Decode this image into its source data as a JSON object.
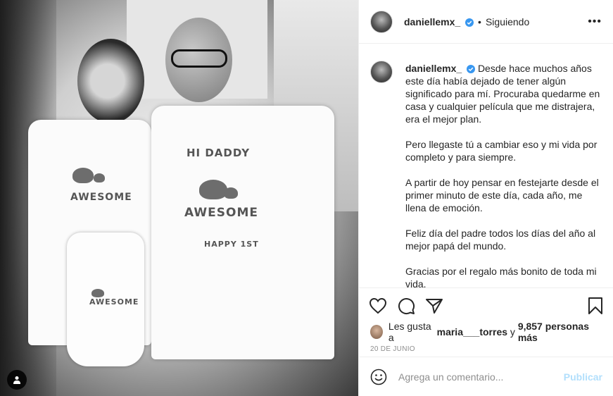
{
  "post": {
    "image_tag_icon": "user-tag-icon",
    "shirt_texts": {
      "hi_daddy": "HI DADDY",
      "awesome_big": "AWESOME",
      "happy_first": "HAPPY 1ST",
      "awesome_left": "AWESOME",
      "awesome_onesie": "AWESOME"
    }
  },
  "header": {
    "username": "daniellemx_",
    "separator": "•",
    "follow_status": "Siguiendo",
    "more_icon": "more-options-icon",
    "more_label": "•••"
  },
  "caption": {
    "username": "daniellemx_",
    "paragraphs": [
      "Desde hace muchos años este día había dejado de tener algún significado para mí. Procuraba quedarme en casa y cualquier película que me distrajera, era el mejor plan.",
      "Pero llegaste tú a cambiar eso y mi vida por completo y para siempre.",
      "A partir de hoy pensar en festejarte desde el primer minuto de este día, cada año, me llena de emoción.",
      "Feliz día del padre todos los días del año al mejor papá del mundo.",
      "Gracias por el regalo más bonito de toda mi vida."
    ]
  },
  "actions": {
    "like_icon": "heart-icon",
    "comment_icon": "comment-icon",
    "share_icon": "share-icon",
    "save_icon": "bookmark-icon"
  },
  "likes": {
    "prefix": "Les gusta a",
    "user": "maria___torres",
    "joiner": "y",
    "others": "9,857 personas más"
  },
  "date": "20 DE JUNIO",
  "comment": {
    "placeholder": "Agrega un comentario...",
    "publish_label": "Publicar",
    "emoji_icon": "emoji-icon"
  },
  "colors": {
    "verified": "#3897f0",
    "publish_disabled": "#b2dffc",
    "muted": "#8e8e8e"
  }
}
